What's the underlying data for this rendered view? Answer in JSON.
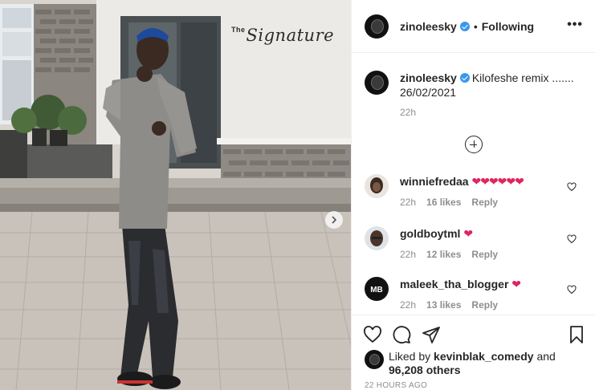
{
  "post": {
    "username": "zinoleesky",
    "follow_status": "Following",
    "dot": "•",
    "more": "•••",
    "sign_word": "The",
    "sign_script": "Signature"
  },
  "caption": {
    "username": "zinoleesky",
    "text": "Kilofeshe remix .......",
    "date": "26/02/2021",
    "time": "22h"
  },
  "comments": [
    {
      "username": "winniefredaa",
      "text": "❤❤❤❤❤❤",
      "time": "22h",
      "likes": "16 likes",
      "reply": "Reply"
    },
    {
      "username": "goldboytml",
      "text": "❤",
      "time": "22h",
      "likes": "12 likes",
      "reply": "Reply"
    },
    {
      "username": "maleek_tha_blogger",
      "text": "❤",
      "time": "22h",
      "likes": "13 likes",
      "reply": "Reply"
    }
  ],
  "likes": {
    "prefix": "Liked by",
    "user": "kevinblak_comedy",
    "and": "and",
    "others": "96,208 others"
  },
  "timestamp": "22 HOURS AGO",
  "icons": {
    "like": "heart-icon",
    "comment": "comment-icon",
    "share": "paper-plane-icon",
    "save": "bookmark-icon",
    "more": "more-options-icon",
    "next": "chevron-right-icon",
    "load": "plus-circle-icon",
    "verified": "verified-badge-icon"
  },
  "colors": {
    "verified": "#3897f0",
    "heart": "#e0245e",
    "secondary_text": "#8e8e8e",
    "border": "#efefef"
  }
}
